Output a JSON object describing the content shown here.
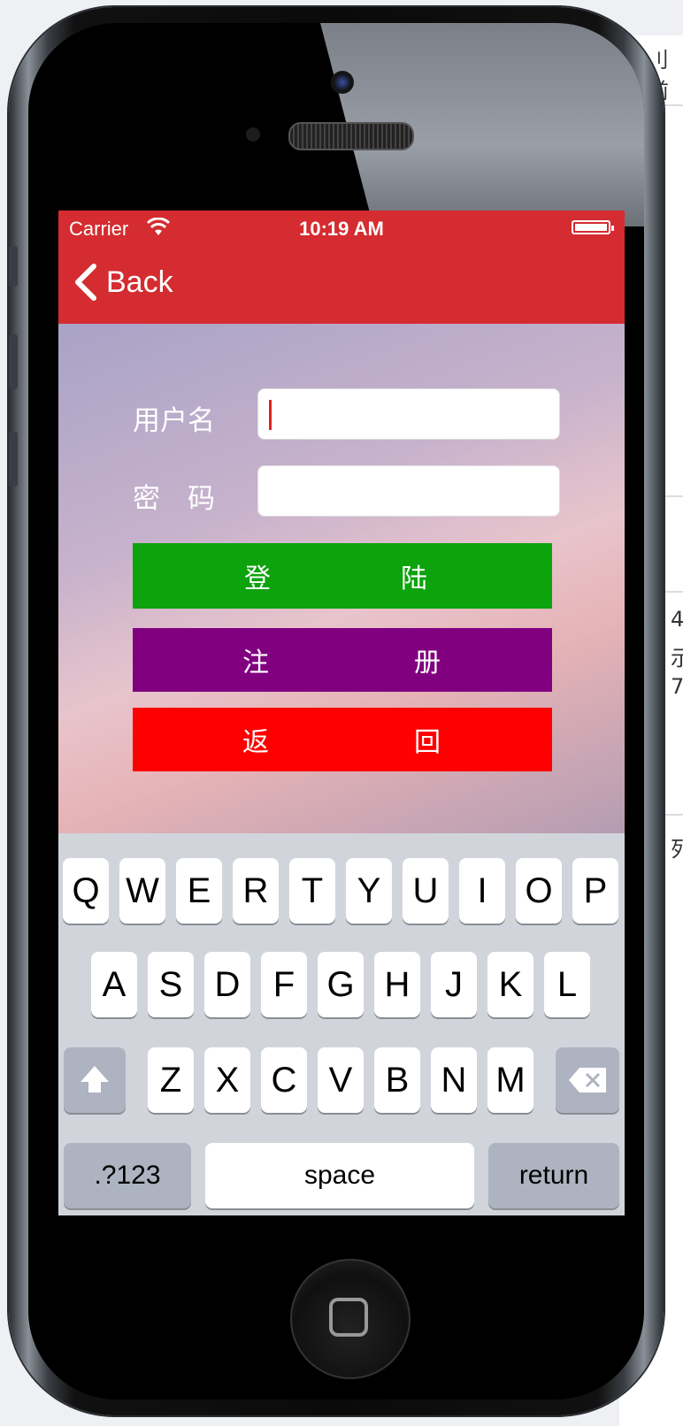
{
  "background": {
    "fragments": [
      "刂前",
      "4",
      "示",
      "7",
      "列"
    ]
  },
  "status_bar": {
    "carrier": "Carrier",
    "time": "10:19 AM"
  },
  "nav": {
    "back_label": "Back"
  },
  "form": {
    "username_label": "用户名",
    "password_label": "密　码",
    "username_value": "",
    "password_value": ""
  },
  "buttons": {
    "login": {
      "chars": [
        "登",
        "陆"
      ],
      "color": "#0ca30c"
    },
    "register": {
      "chars": [
        "注",
        "册"
      ],
      "color": "#800080"
    },
    "back": {
      "chars": [
        "返",
        "回"
      ],
      "color": "#ff0000"
    }
  },
  "keyboard": {
    "row1": [
      "Q",
      "W",
      "E",
      "R",
      "T",
      "Y",
      "U",
      "I",
      "O",
      "P"
    ],
    "row2": [
      "A",
      "S",
      "D",
      "F",
      "G",
      "H",
      "J",
      "K",
      "L"
    ],
    "row3": [
      "Z",
      "X",
      "C",
      "V",
      "B",
      "N",
      "M"
    ],
    "numbers_label": ".?123",
    "space_label": "space",
    "return_label": "return"
  },
  "colors": {
    "navbar": "#d42c30",
    "keyboard": "#d1d5db"
  }
}
